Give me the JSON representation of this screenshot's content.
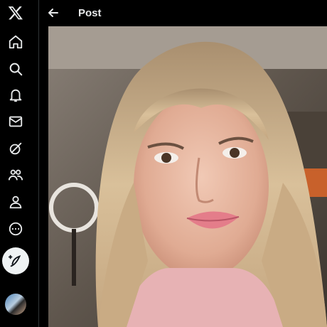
{
  "header": {
    "title": "Post",
    "back_icon": "arrow-left-icon"
  },
  "sidebar": {
    "items": [
      {
        "icon": "x-logo-icon"
      },
      {
        "icon": "home-icon"
      },
      {
        "icon": "search-icon"
      },
      {
        "icon": "notifications-bell-icon"
      },
      {
        "icon": "messages-envelope-icon"
      },
      {
        "icon": "grok-icon"
      },
      {
        "icon": "communities-icon"
      },
      {
        "icon": "profile-icon"
      },
      {
        "icon": "more-icon"
      }
    ],
    "compose_icon": "compose-feather-icon",
    "avatar": "account-avatar"
  },
  "media": {
    "subject": "selfie-photo"
  },
  "colors": {
    "background": "#000000",
    "text": "#e7e9ea",
    "compose_bg": "#eff3f4"
  }
}
